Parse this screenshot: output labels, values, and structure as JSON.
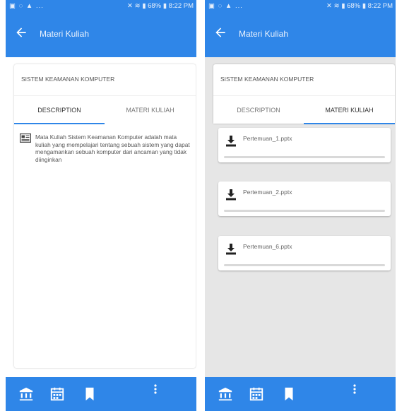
{
  "status_bar": {
    "left_icons": [
      "gallery-icon",
      "whatsapp-icon",
      "person-icon"
    ],
    "left_more": "...",
    "battery": "68%",
    "time": "8:22 PM"
  },
  "app_bar": {
    "title": "Materi Kuliah",
    "back_icon": "arrow-left-icon"
  },
  "course": {
    "name": "SISTEM KEAMANAN KOMPUTER"
  },
  "tabs": [
    {
      "label": "DESCRIPTION"
    },
    {
      "label": "MATERI KULIAH"
    }
  ],
  "left_screen": {
    "active_tab": "DESCRIPTION",
    "description": "Mata Kuliah Sistem Keamanan Komputer adalah mata kuliah yang mempelajari tentang sebuah sistem yang dapat mengamankan sebuah komputer dari ancaman yang tidak diinginkan",
    "description_icon": "news-icon"
  },
  "right_screen": {
    "active_tab": "MATERI KULIAH",
    "files": [
      {
        "name": "Pertemuan_1.pptx"
      },
      {
        "name": "Pertemuan_2.pptx"
      },
      {
        "name": "Pertemuan_6.pptx"
      }
    ]
  },
  "bottom_nav": {
    "items": [
      "bank-icon",
      "calendar-icon",
      "bookmark-icon",
      "more-vertical-icon"
    ]
  },
  "colors": {
    "primary": "#2f86e8",
    "content_gray": "#e6e6e6"
  }
}
